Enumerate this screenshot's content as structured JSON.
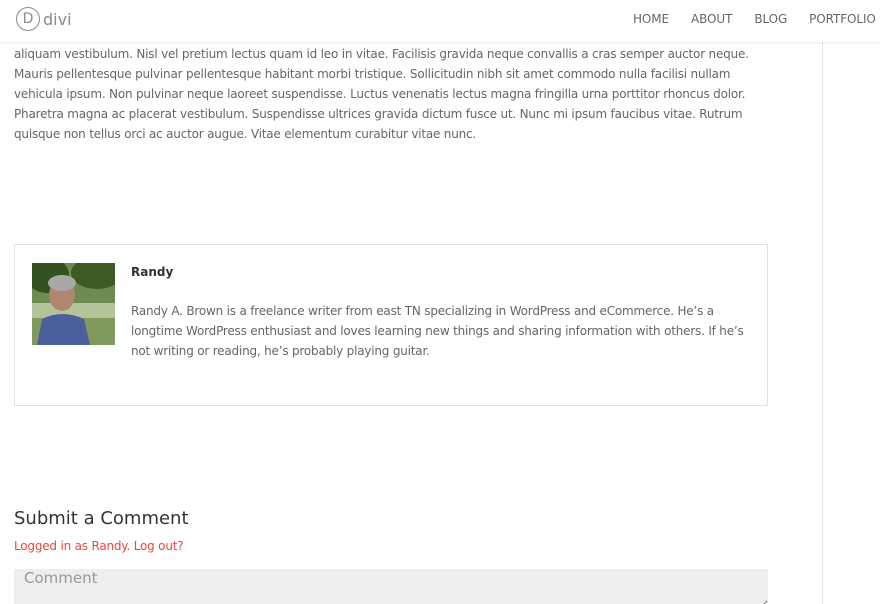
{
  "header": {
    "logo_letter": "D",
    "logo_text": "divi",
    "nav": [
      {
        "label": "HOME"
      },
      {
        "label": "ABOUT"
      },
      {
        "label": "BLOG"
      },
      {
        "label": "PORTFOLIO"
      }
    ]
  },
  "article": {
    "body_text": "aliquam vestibulum. Nisl vel pretium lectus quam id leo in vitae. Facilisis gravida neque convallis a cras semper auctor neque. Mauris pellentesque pulvinar pellentesque habitant morbi tristique. Sollicitudin nibh sit amet commodo nulla facilisi nullam vehicula ipsum. Non pulvinar neque laoreet suspendisse. Luctus venenatis lectus magna fringilla urna porttitor rhoncus dolor. Pharetra magna ac placerat vestibulum. Suspendisse ultrices gravida dictum fusce ut. Nunc mi ipsum faucibus vitae. Rutrum quisque non tellus orci ac auctor augue. Vitae elementum curabitur vitae nunc."
  },
  "author": {
    "name": "Randy",
    "bio": "Randy A. Brown is a freelance writer from east TN specializing in WordPress and eCommerce. He’s a longtime WordPress enthusiast and loves learning new things and sharing information with others. If he’s not writing or reading, he’s probably playing guitar.",
    "photo_alt": "Randy author photo"
  },
  "comments": {
    "title": "Submit a Comment",
    "logged_in_text": "Logged in as Randy.",
    "logout_label": "Log out?",
    "comment_placeholder": "Comment"
  },
  "colors": {
    "accent": "#e8473f",
    "input_bg": "#eeeeee"
  }
}
